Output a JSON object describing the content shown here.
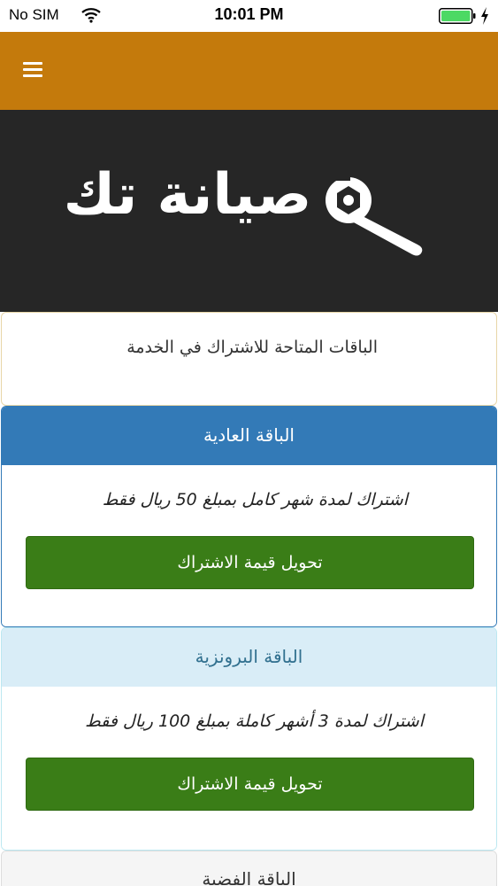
{
  "status_bar": {
    "carrier": "No SIM",
    "time": "10:01 PM",
    "wifi_icon": "wifi-icon",
    "battery_icon": "battery-icon",
    "charging_icon": "charging-bolt-icon"
  },
  "header": {
    "menu_icon": "hamburger-menu-icon",
    "color": "#c47a0c"
  },
  "banner": {
    "logo_text": "صيانة تك",
    "logo_icon": "wrench-icon",
    "background": "#262626"
  },
  "intro": {
    "text": "الباقات المتاحة للاشتراك في الخدمة"
  },
  "packages": [
    {
      "title": "الباقة العادية",
      "description": "اشتراك لمدة شهر كامل بمبلغ 50 ريال فقط",
      "button_label": "تحويل قيمة الاشتراك",
      "header_color": "#337ab7"
    },
    {
      "title": "الباقة البرونزية",
      "description": "اشتراك لمدة 3 أشهر كاملة بمبلغ 100 ريال فقط",
      "button_label": "تحويل قيمة الاشتراك",
      "header_color": "#d9edf7"
    },
    {
      "title": "الباقة الفضية",
      "header_color": "#f5f5f5"
    }
  ],
  "colors": {
    "button": "#3a7d17"
  }
}
